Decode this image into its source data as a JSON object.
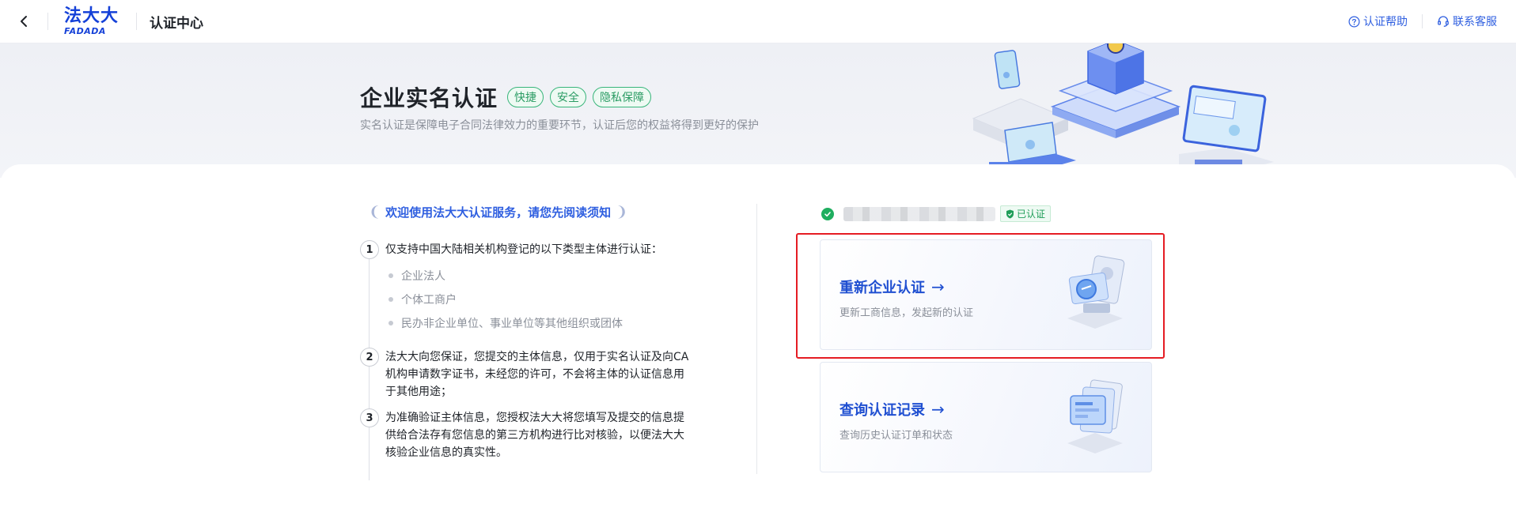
{
  "header": {
    "logo_cn": "法大大",
    "logo_en": "FADADA",
    "title": "认证中心",
    "help_label": "认证帮助",
    "service_label": "联系客服"
  },
  "banner": {
    "title": "企业实名认证",
    "tags": [
      "快捷",
      "安全",
      "隐私保障"
    ],
    "subtitle": "实名认证是保障电子合同法律效力的重要环节，认证后您的权益将得到更好的保护"
  },
  "notice": {
    "title": "欢迎使用法大大认证服务，请您先阅读须知",
    "steps": [
      {
        "num": "1",
        "text": "仅支持中国大陆相关机构登记的以下类型主体进行认证：",
        "items": [
          "企业法人",
          "个体工商户",
          "民办非企业单位、事业单位等其他组织或团体"
        ]
      },
      {
        "num": "2",
        "text": "法大大向您保证，您提交的主体信息，仅用于实名认证及向CA机构申请数字证书，未经您的许可，不会将主体的认证信息用于其他用途；"
      },
      {
        "num": "3",
        "text": "为准确验证主体信息，您授权法大大将您填写及提交的信息提供给合法存有您信息的第三方机构进行比对核验，以便法大大核验企业信息的真实性。"
      }
    ]
  },
  "account": {
    "status": "已认证"
  },
  "cards": [
    {
      "title": "重新企业认证",
      "arrow": "→",
      "desc": "更新工商信息，发起新的认证",
      "icon": "id-card-icon"
    },
    {
      "title": "查询认证记录",
      "arrow": "→",
      "desc": "查询历史认证订单和状态",
      "icon": "records-icon"
    }
  ],
  "colors": {
    "brand": "#1541d8",
    "link": "#2f5fe0",
    "success": "#1fae5f",
    "highlight": "#e51c23"
  }
}
